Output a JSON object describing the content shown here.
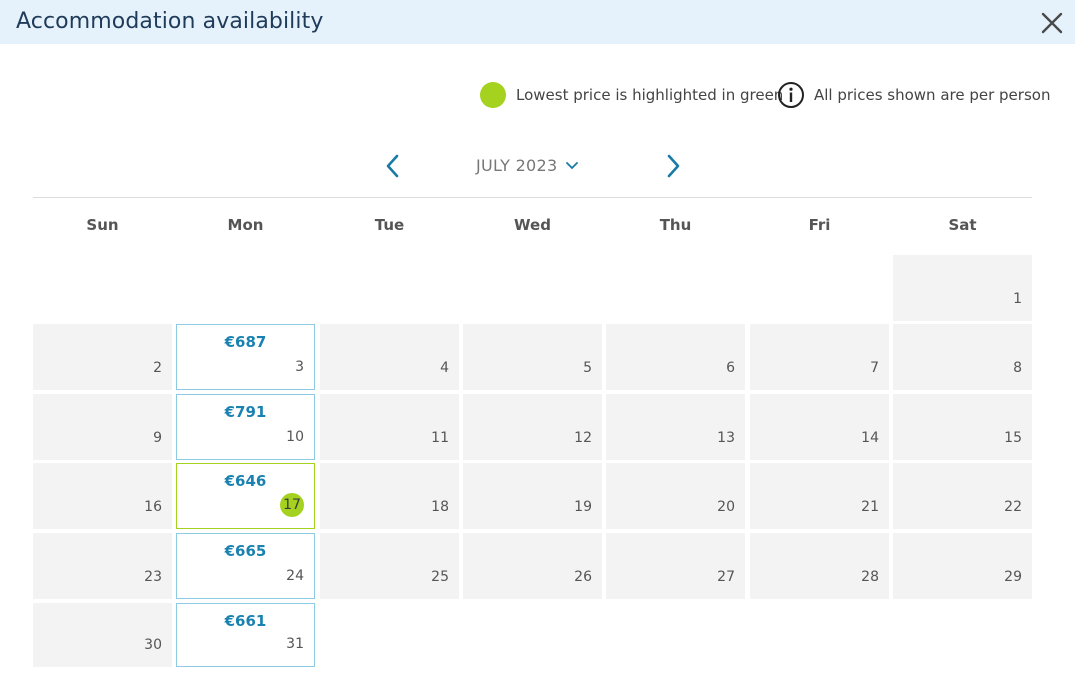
{
  "header": {
    "title": "Accommodation availability"
  },
  "legend": {
    "lowest_price_text": "Lowest price is highlighted in green",
    "per_person_text": "All prices shown are per person"
  },
  "calendar": {
    "month_label": "JULY 2023",
    "weekdays": [
      "Sun",
      "Mon",
      "Tue",
      "Wed",
      "Thu",
      "Fri",
      "Sat"
    ],
    "days": [
      {
        "num": "1"
      },
      {
        "num": "2"
      },
      {
        "num": "3",
        "price": "€687"
      },
      {
        "num": "4"
      },
      {
        "num": "5"
      },
      {
        "num": "6"
      },
      {
        "num": "7"
      },
      {
        "num": "8"
      },
      {
        "num": "9"
      },
      {
        "num": "10",
        "price": "€791"
      },
      {
        "num": "11"
      },
      {
        "num": "12"
      },
      {
        "num": "13"
      },
      {
        "num": "14"
      },
      {
        "num": "15"
      },
      {
        "num": "16"
      },
      {
        "num": "17",
        "price": "€646",
        "lowest": true
      },
      {
        "num": "18"
      },
      {
        "num": "19"
      },
      {
        "num": "20"
      },
      {
        "num": "21"
      },
      {
        "num": "22"
      },
      {
        "num": "23"
      },
      {
        "num": "24",
        "price": "€665"
      },
      {
        "num": "25"
      },
      {
        "num": "26"
      },
      {
        "num": "27"
      },
      {
        "num": "28"
      },
      {
        "num": "29"
      },
      {
        "num": "30"
      },
      {
        "num": "31",
        "price": "€661"
      }
    ]
  },
  "colors": {
    "accent_blue": "#1a82b0",
    "lowest_green": "#a4d21f",
    "header_bg": "#e6f2fb"
  }
}
